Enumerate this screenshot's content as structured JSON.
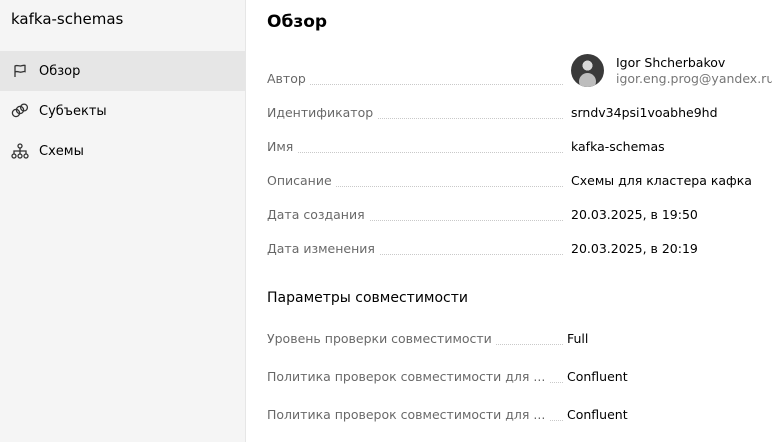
{
  "sidebar": {
    "title": "kafka-schemas",
    "items": [
      {
        "label": "Обзор",
        "icon": "flag-icon",
        "active": true
      },
      {
        "label": "Субъекты",
        "icon": "subjects-icon",
        "active": false
      },
      {
        "label": "Схемы",
        "icon": "hierarchy-icon",
        "active": false
      }
    ]
  },
  "main": {
    "title": "Обзор",
    "author": {
      "label": "Автор",
      "name": "Igor Shcherbakov",
      "email": "igor.eng.prog@yandex.ru"
    },
    "fields": [
      {
        "label": "Идентификатор",
        "value": "srndv34psi1voabhe9hd"
      },
      {
        "label": "Имя",
        "value": "kafka-schemas"
      },
      {
        "label": "Описание",
        "value": "Схемы для кластера кафка"
      },
      {
        "label": "Дата создания",
        "value": "20.03.2025, в 19:50"
      },
      {
        "label": "Дата изменения",
        "value": "20.03.2025, в 20:19"
      }
    ],
    "compat": {
      "title": "Параметры совместимости",
      "fields": [
        {
          "label": "Уровень проверки совместимости",
          "value": "Full"
        },
        {
          "label": "Политика проверок совместимости для ...",
          "value": "Confluent"
        },
        {
          "label": "Политика проверок совместимости для ...",
          "value": "Confluent"
        }
      ]
    }
  }
}
